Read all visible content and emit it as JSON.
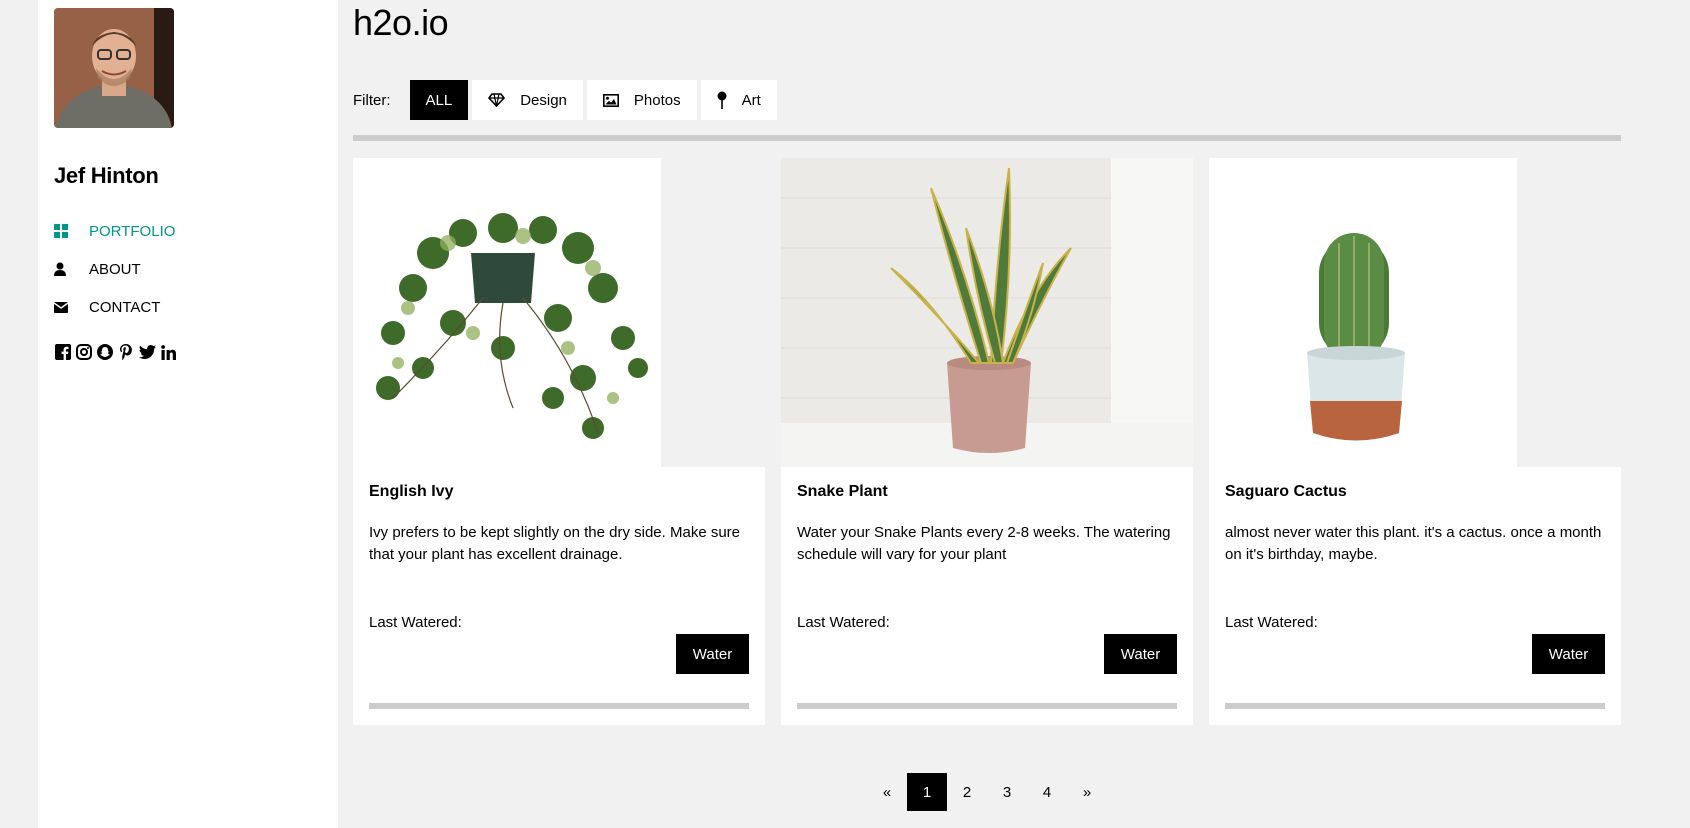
{
  "sidebar": {
    "user_name": "Jef Hinton",
    "nav": [
      {
        "label": "PORTFOLIO",
        "icon": "grid-icon",
        "active": true
      },
      {
        "label": "ABOUT",
        "icon": "user-icon",
        "active": false
      },
      {
        "label": "CONTACT",
        "icon": "envelope-icon",
        "active": false
      }
    ],
    "social": [
      "facebook-icon",
      "instagram-icon",
      "snapchat-icon",
      "pinterest-icon",
      "twitter-icon",
      "linkedin-icon"
    ]
  },
  "header": {
    "title": "h2o.io"
  },
  "filter": {
    "label": "Filter:",
    "buttons": [
      {
        "label": "ALL",
        "active": true
      },
      {
        "label": "Design",
        "icon": "diamond-icon"
      },
      {
        "label": "Photos",
        "icon": "photo-icon"
      },
      {
        "label": "Art",
        "icon": "map-pin-icon"
      }
    ]
  },
  "cards": [
    {
      "title": "English Ivy",
      "description": "Ivy prefers to be kept slightly on the dry side. Make sure that your plant has excellent drainage.",
      "last_watered_label": "Last Watered:",
      "button_label": "Water"
    },
    {
      "title": "Snake Plant",
      "description": "Water your Snake Plants every 2-8 weeks. The watering schedule will vary for your plant",
      "last_watered_label": "Last Watered:",
      "button_label": "Water"
    },
    {
      "title": "Saguaro Cactus",
      "description": "almost never water this plant. it's a cactus. once a month on it's birthday, maybe.",
      "last_watered_label": "Last Watered:",
      "button_label": "Water"
    }
  ],
  "pagination": {
    "prev": "«",
    "pages": [
      "1",
      "2",
      "3",
      "4"
    ],
    "current": "1",
    "next": "»"
  },
  "colors": {
    "accent": "#009688",
    "dark": "#000000",
    "bar": "#cccccc",
    "background": "#f1f1f1"
  }
}
